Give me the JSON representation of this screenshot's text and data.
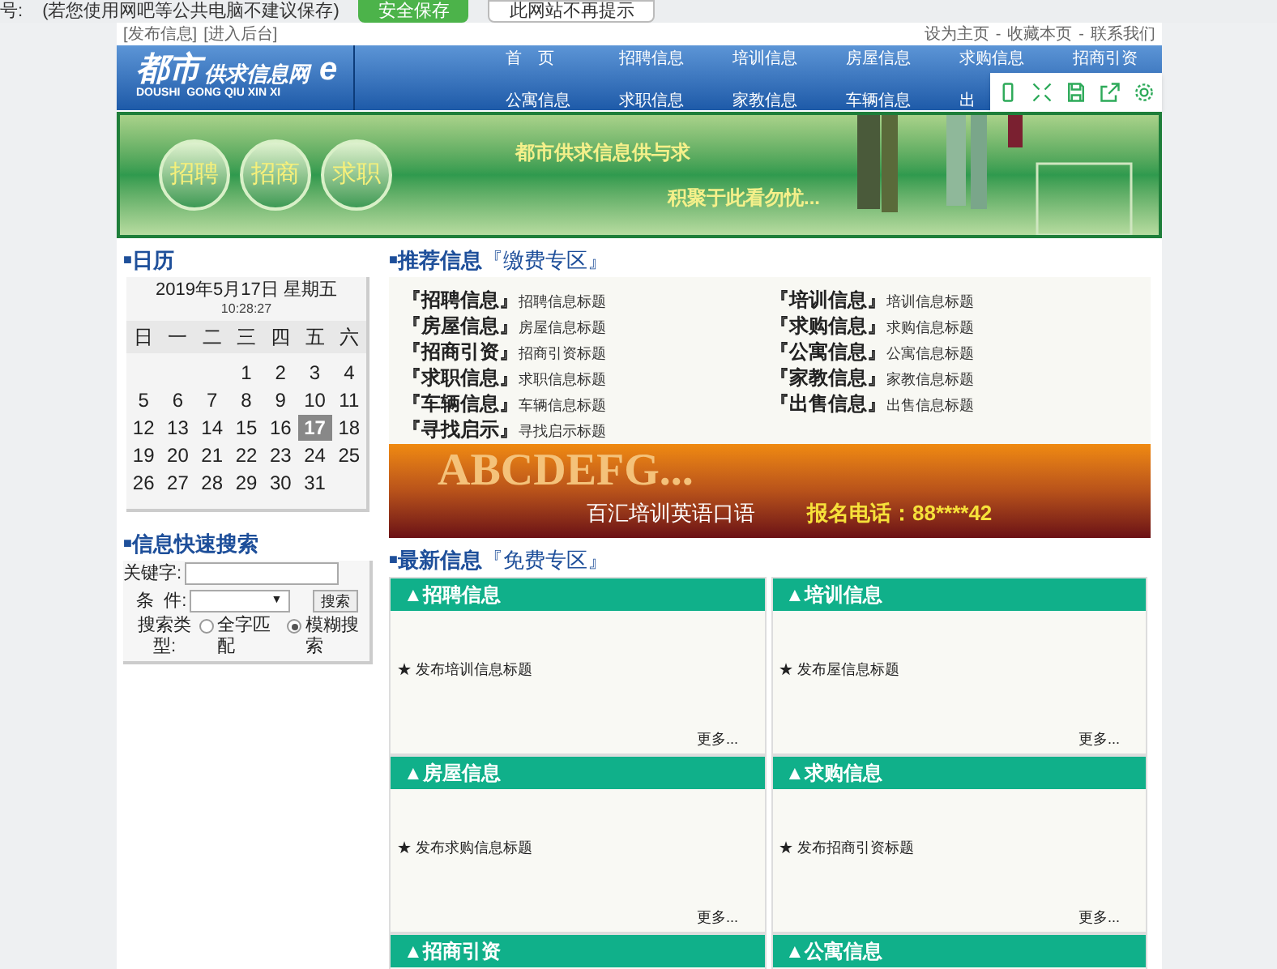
{
  "notice_bar": {
    "label": "号:",
    "hint": "(若您使用网吧等公共电脑不建议保存)",
    "buttons": [
      {
        "label": "安全保存",
        "kind": "primary"
      },
      {
        "label": "此网站不再提示",
        "kind": "plain"
      }
    ]
  },
  "top_links": {
    "left": [
      "[发布信息]",
      "[进入后台]"
    ],
    "right": [
      "设为主页",
      "收藏本页",
      "联系我们"
    ],
    "separator": "-"
  },
  "logo": {
    "big": "都市",
    "small": "供求信息网",
    "mark": "e",
    "pinyin": "DOUSHI  GONG QIU XIN XI"
  },
  "nav": [
    [
      "首　页",
      "招聘信息",
      "培训信息",
      "房屋信息",
      "求购信息",
      "招商引资"
    ],
    [
      "公寓信息",
      "求职信息",
      "家教信息",
      "车辆信息",
      "出"
    ]
  ],
  "banner": {
    "circles": [
      "招聘",
      "招商",
      "求职"
    ],
    "slogan": [
      "都市供求信息供与求",
      "积聚于此看勿忧..."
    ]
  },
  "calendar": {
    "bullet": "■",
    "title": "日历",
    "date": "2019年5月17日 星期五",
    "time": "10:28:27",
    "weekdays": [
      "日",
      "一",
      "二",
      "三",
      "四",
      "五",
      "六"
    ],
    "weeks": [
      [
        {
          "day": "1",
          "selected": false
        },
        {
          "day": "2",
          "selected": false
        },
        {
          "day": "3",
          "selected": false
        },
        {
          "day": "4",
          "selected": false
        }
      ],
      [
        {
          "day": "5",
          "selected": false
        },
        {
          "day": "6",
          "selected": false
        },
        {
          "day": "7",
          "selected": false
        },
        {
          "day": "8",
          "selected": false
        },
        {
          "day": "9",
          "selected": false
        },
        {
          "day": "10",
          "selected": false
        },
        {
          "day": "11",
          "selected": false
        }
      ],
      [
        {
          "day": "12",
          "selected": false
        },
        {
          "day": "13",
          "selected": false
        },
        {
          "day": "14",
          "selected": false
        },
        {
          "day": "15",
          "selected": false
        },
        {
          "day": "16",
          "selected": false
        },
        {
          "day": "17",
          "selected": true
        },
        {
          "day": "18",
          "selected": false
        }
      ],
      [
        {
          "day": "19",
          "selected": false
        },
        {
          "day": "20",
          "selected": false
        },
        {
          "day": "21",
          "selected": false
        },
        {
          "day": "22",
          "selected": false
        },
        {
          "day": "23",
          "selected": false
        },
        {
          "day": "24",
          "selected": false
        },
        {
          "day": "25",
          "selected": false
        }
      ],
      [
        {
          "day": "26",
          "selected": false
        },
        {
          "day": "27",
          "selected": false
        },
        {
          "day": "28",
          "selected": false
        },
        {
          "day": "29",
          "selected": false
        },
        {
          "day": "30",
          "selected": false
        },
        {
          "day": "31",
          "selected": false
        }
      ]
    ]
  },
  "search": {
    "bullet": "■",
    "caret": "▼",
    "title": "信息快速搜索",
    "keyword_label": "关键字:",
    "condition_label": "条  件:",
    "button": "搜索",
    "type_label": "搜索类型:",
    "options": [
      {
        "label": "全字匹配",
        "selected": false
      },
      {
        "label": "模糊搜索",
        "selected": true
      }
    ]
  },
  "recommended": {
    "bullet": "■",
    "title": "推荐信息",
    "zone": "『缴费专区』",
    "items": [
      {
        "category": "『招聘信息』",
        "text": "招聘信息标题"
      },
      {
        "category": "『培训信息』",
        "text": "培训信息标题"
      },
      {
        "category": "『房屋信息』",
        "text": "房屋信息标题"
      },
      {
        "category": "『求购信息』",
        "text": "求购信息标题"
      },
      {
        "category": "『招商引资』",
        "text": "招商引资标题"
      },
      {
        "category": "『公寓信息』",
        "text": "公寓信息标题"
      },
      {
        "category": "『求职信息』",
        "text": "求职信息标题"
      },
      {
        "category": "『家教信息』",
        "text": "家教信息标题"
      },
      {
        "category": "『车辆信息』",
        "text": "车辆信息标题"
      },
      {
        "category": "『出售信息』",
        "text": "出售信息标题"
      },
      {
        "category": "『寻找启示』",
        "text": "寻找启示标题"
      }
    ]
  },
  "ad": {
    "headline": "ABCDEFG...",
    "course": "百汇培训英语口语",
    "phone": "报名电话：88****42"
  },
  "latest": {
    "bullet": "■",
    "title": "最新信息",
    "zone": "『免费专区』",
    "panels": [
      {
        "title": "▲招聘信息",
        "items": [
          "★ 发布培训信息标题"
        ],
        "more": "更多..."
      },
      {
        "title": "▲培训信息",
        "items": [
          "★ 发布屋信息标题"
        ],
        "more": "更多..."
      },
      {
        "title": "▲房屋信息",
        "items": [
          "★ 发布求购信息标题"
        ],
        "more": "更多..."
      },
      {
        "title": "▲求购信息",
        "items": [
          "★ 发布招商引资标题"
        ],
        "more": "更多..."
      },
      {
        "title": "▲招商引资"
      },
      {
        "title": "▲公寓信息"
      }
    ]
  }
}
